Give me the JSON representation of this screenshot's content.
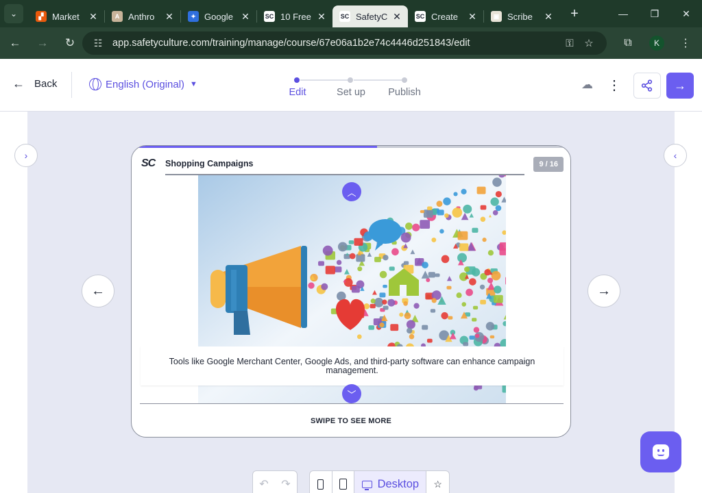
{
  "browser": {
    "tabs": [
      {
        "title": "Market",
        "fav_color": "#e8590c",
        "fav_glyph": "▞"
      },
      {
        "title": "Anthro",
        "fav_color": "#c8b49a",
        "fav_glyph": "A"
      },
      {
        "title": "Google",
        "fav_color": "#2f6fdd",
        "fav_glyph": "✦"
      },
      {
        "title": "10 Free",
        "fav_color": "#ffffff",
        "fav_glyph": "SC"
      },
      {
        "title": "SafetyC",
        "fav_color": "#ffffff",
        "fav_glyph": "SC"
      },
      {
        "title": "Create",
        "fav_color": "#ffffff",
        "fav_glyph": "SC"
      },
      {
        "title": "Scribe",
        "fav_color": "#e9e4d8",
        "fav_glyph": "▣"
      }
    ],
    "active_tab_index": 4,
    "url": "app.safetyculture.com/training/manage/course/67e06a1b2e74c4446d251843/edit",
    "profile_initial": "K"
  },
  "header": {
    "back_label": "Back",
    "language": "English (Original)",
    "steps": [
      "Edit",
      "Set up",
      "Publish"
    ],
    "active_step": 0
  },
  "card": {
    "progress": 0.56,
    "logo": "SC",
    "title": "Shopping Campaigns",
    "counter": "9 / 16",
    "caption": "Tools like Google Merchant Center, Google Ads, and third-party software can enhance campaign management.",
    "swipe_label": "SWIPE TO SEE MORE"
  },
  "bottom": {
    "desktop_label": "Desktop",
    "active_device": "desktop"
  },
  "colors": {
    "accent": "#6b5ef0",
    "accent_text": "#5b4fe0",
    "browser_frame": "#1f3a2a"
  },
  "icons": {
    "back": "arrow-left-icon",
    "language": "globe-icon",
    "sync": "cloud-sync-icon",
    "more": "kebab-icon",
    "share": "share-icon",
    "next": "arrow-right-icon",
    "prev_slide": "arrow-left-icon",
    "next_slide": "arrow-right-icon",
    "help": "chat-bot-icon"
  }
}
